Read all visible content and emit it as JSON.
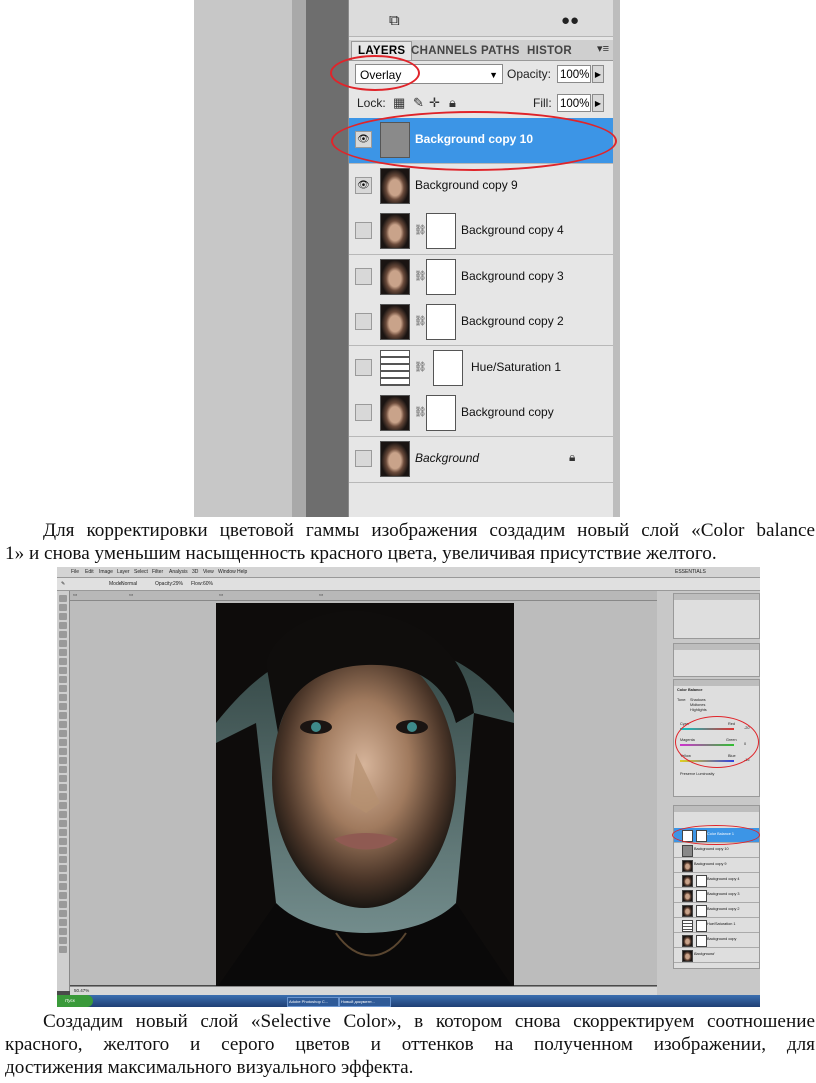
{
  "layers_panel": {
    "tabs": [
      "LAYERS",
      "CHANNELS",
      "PATHS",
      "HISTOR"
    ],
    "blend_mode": "Overlay",
    "opacity_label": "Opacity:",
    "opacity_value": "100%",
    "lock_label": "Lock:",
    "fill_label": "Fill:",
    "fill_value": "100%",
    "layers": [
      {
        "name": "Background copy 10",
        "visible": true,
        "selected": true
      },
      {
        "name": "Background copy 9",
        "visible": true,
        "selected": false
      },
      {
        "name": "Background copy 4",
        "visible": false,
        "selected": false
      },
      {
        "name": "Background copy 3",
        "visible": false,
        "selected": false
      },
      {
        "name": "Background copy 2",
        "visible": false,
        "selected": false
      },
      {
        "name": "Hue/Saturation 1",
        "visible": false,
        "selected": false
      },
      {
        "name": "Background copy",
        "visible": false,
        "selected": false
      },
      {
        "name": "Background",
        "visible": false,
        "selected": false,
        "locked": true
      }
    ],
    "highlight_color": "#3c95e6",
    "annotation_color": "#e0242a"
  },
  "paragraph_1": {
    "line_1": "Для корректировки цветовой гаммы изображения создадим новый слой «Color balance",
    "line_2": "1» и снова уменьшим насыщенность красного цвета, увеличивая присутствие желтого."
  },
  "photoshop_window": {
    "menu": [
      "File",
      "Edit",
      "Image",
      "Layer",
      "Select",
      "Filter",
      "Analysis",
      "3D",
      "View",
      "Window",
      "Help"
    ],
    "workspace": "ESSENTIALS",
    "mode_label": "Mode:",
    "mode_value": "Normal",
    "opacity_label": "Opacity:",
    "opacity_value": "29%",
    "flow_label": "Flow:",
    "flow_value": "60%",
    "zoom_status": "50.47%",
    "adjustment_title": "Color Balance",
    "tone_label": "Tone:",
    "tone_options": [
      "Shadows",
      "Midtones",
      "Highlights"
    ],
    "slider_rows": [
      {
        "left": "Cyan",
        "right": "Red",
        "value": "-20"
      },
      {
        "left": "Magenta",
        "right": "Green",
        "value": "0"
      },
      {
        "left": "Yellow",
        "right": "Blue",
        "value": "-15"
      }
    ],
    "preserve_luminosity": "Preserve Luminosity",
    "small_layers": [
      {
        "name": "Color Balance 1",
        "selected": true
      },
      {
        "name": "Background copy 10",
        "selected": false
      },
      {
        "name": "Background copy 9",
        "selected": false
      },
      {
        "name": "Background copy 4",
        "selected": false
      },
      {
        "name": "Background copy 3",
        "selected": false
      },
      {
        "name": "Background copy 2",
        "selected": false
      },
      {
        "name": "Hue/Saturation 1",
        "selected": false
      },
      {
        "name": "Background copy",
        "selected": false
      },
      {
        "name": "Background",
        "selected": false
      }
    ],
    "taskbar_items": [
      "Пуск",
      "Adobe Photoshop C...",
      "Новый документ..."
    ]
  },
  "paragraph_2": {
    "line_1": "Создадим новый слой «Selective Color», в котором снова скорректируем соотношение",
    "line_2": "красного, желтого и серого цветов и оттенков на полученном изображении, для",
    "line_3": "достижения максимального визуального эффекта."
  }
}
